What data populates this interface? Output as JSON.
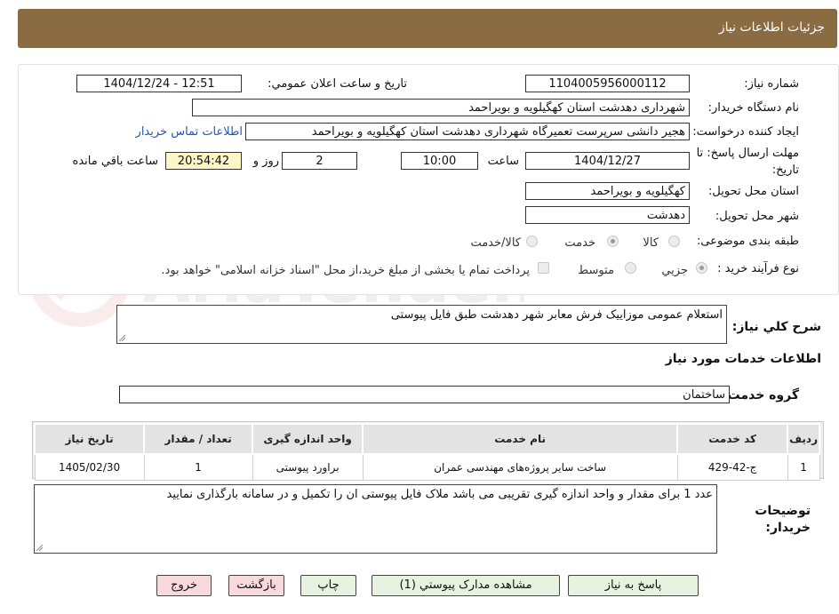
{
  "header": {
    "title": "جزئیات اطلاعات نیاز"
  },
  "form": {
    "need_number_label": "شماره نیاز:",
    "need_number": "1104005956000112",
    "announce_label": "تاریخ و ساعت اعلان عمومي:",
    "announce_value": "1404/12/24 - 12:51",
    "buyer_label": "نام دستگاه خریدار:",
    "buyer_value": "شهرداری دهدشت استان کهگیلویه و بویراحمد",
    "creator_label": "ایجاد کننده درخواست:",
    "creator_value": "هجیر دانشی سرپرست تعمیرگاه شهرداری دهدشت استان کهگیلویه و بویراحمد",
    "contact_link": "اطلاعات تماس خریدار",
    "deadline_label_1": "مهلت ارسال پاسخ: تا",
    "deadline_label_2": "تاریخ:",
    "deadline_date": "1404/12/27",
    "time_label": "ساعت",
    "deadline_time": "10:00",
    "days_value": "2",
    "days_label": "روز و",
    "remaining_time": "20:54:42",
    "remaining_label": "ساعت باقي مانده",
    "province_label": "استان محل تحویل:",
    "province_value": "کهگیلویه و بویراحمد",
    "city_label": "شهر محل تحویل:",
    "city_value": "دهدشت",
    "category_label": "طبقه بندی موضوعی:",
    "category_options": [
      "کالا",
      "خدمت",
      "کالا/خدمت"
    ],
    "category_selected": "خدمت",
    "process_label": "نوع فرآیند خرید :",
    "process_options": [
      "جزيي",
      "متوسط"
    ],
    "process_selected": "جزيي",
    "treasury_note": "پرداخت تمام یا بخشی از مبلغ خرید،از محل \"اسناد خزانه اسلامی\" خواهد بود."
  },
  "description": {
    "label": "شرح کلي نیاز:",
    "value": "استعلام عمومی موزاییک فرش معابر شهر دهدشت طبق فایل پیوستی"
  },
  "services_heading": "اطلاعات خدمات مورد نیاز",
  "service_group": {
    "label": "گروه خدمت:",
    "value": "ساختمان"
  },
  "table": {
    "headers": [
      "ردیف",
      "کد خدمت",
      "نام خدمت",
      "واحد اندازه گیری",
      "تعداد / مقدار",
      "تاریخ نیاز"
    ],
    "rows": [
      [
        "1",
        "ج-42-429",
        "ساخت سایر پروژه‌های مهندسی عمران",
        "براورد پیوستی",
        "1",
        "1405/02/30"
      ]
    ]
  },
  "buyer_notes": {
    "label_1": "توضیحات",
    "label_2": "خریدار:",
    "value": "عدد 1 برای مقدار و واحد اندازه گیری تقریبی می باشد ملاک فایل پیوستی ان را تکمیل و در سامانه بارگذاری نمایید"
  },
  "buttons": {
    "respond": "پاسخ به نیاز",
    "attachments": "مشاهده مدارک پیوستي (1)",
    "print": "چاپ",
    "back": "بازگشت",
    "exit": "خروج"
  },
  "watermark": {
    "brand": "AriaTender.neT"
  },
  "colors": {
    "header": "#8b6b42",
    "link": "#2255bb",
    "btn_green": "#e6f4df",
    "btn_red": "#f7d9de"
  }
}
